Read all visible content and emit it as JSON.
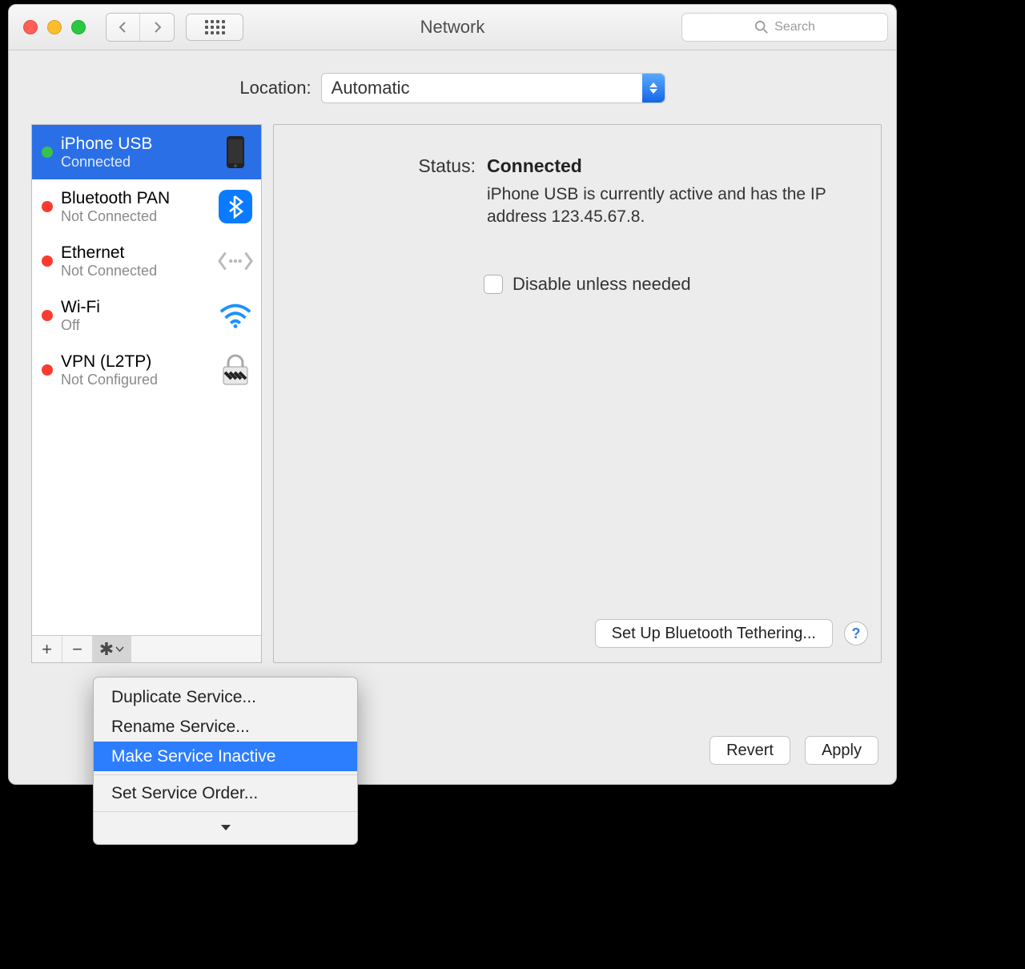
{
  "titlebar": {
    "title": "Network"
  },
  "search": {
    "placeholder": "Search"
  },
  "location": {
    "label": "Location:",
    "value": "Automatic"
  },
  "services": [
    {
      "name": "iPhone USB",
      "status": "Connected",
      "dot": "green",
      "icon": "phone-icon",
      "selected": true
    },
    {
      "name": "Bluetooth PAN",
      "status": "Not Connected",
      "dot": "red",
      "icon": "bluetooth-icon",
      "selected": false
    },
    {
      "name": "Ethernet",
      "status": "Not Connected",
      "dot": "red",
      "icon": "ethernet-icon",
      "selected": false
    },
    {
      "name": "Wi-Fi",
      "status": "Off",
      "dot": "red",
      "icon": "wifi-icon",
      "selected": false
    },
    {
      "name": "VPN (L2TP)",
      "status": "Not Configured",
      "dot": "red",
      "icon": "lock-icon",
      "selected": false
    }
  ],
  "detail": {
    "status_label": "Status:",
    "status_value": "Connected",
    "description": "iPhone USB is currently active and has the IP address 123.45.67.8.",
    "disable_checkbox_label": "Disable unless needed",
    "setup_button": "Set Up Bluetooth Tethering..."
  },
  "buttons": {
    "revert": "Revert",
    "apply": "Apply"
  },
  "menu": {
    "items": [
      {
        "label": "Duplicate Service...",
        "hl": false
      },
      {
        "label": "Rename Service...",
        "hl": false
      },
      {
        "label": "Make Service Inactive",
        "hl": true
      },
      {
        "label": "Set Service Order...",
        "hl": false
      }
    ]
  }
}
